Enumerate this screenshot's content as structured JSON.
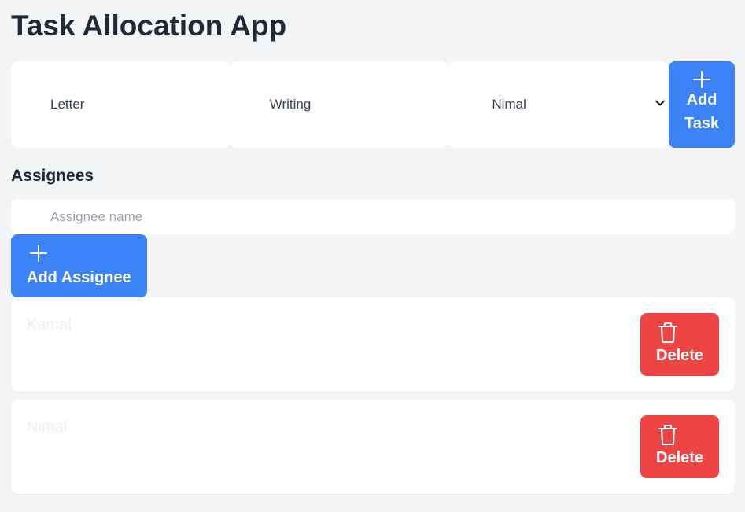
{
  "app": {
    "title": "Task Allocation App"
  },
  "task_form": {
    "title_value": "Letter",
    "description_value": "Writing",
    "assignee_selected": "Nimal",
    "add_button_line1": "Add",
    "add_button_line2": "Task"
  },
  "assignees": {
    "heading": "Assignees",
    "input_placeholder": "Assignee name",
    "add_button_label": "Add Assignee",
    "items": [
      {
        "name": "Kamal",
        "delete_label": "Delete"
      },
      {
        "name": "Nimal",
        "delete_label": "Delete"
      }
    ]
  },
  "colors": {
    "primary": "#3b82f6",
    "danger": "#ef4444",
    "background": "#f3f4f6",
    "card": "#ffffff"
  },
  "icons": {
    "add": "plus-icon",
    "delete": "trash-icon",
    "select": "chevron-down-icon"
  }
}
